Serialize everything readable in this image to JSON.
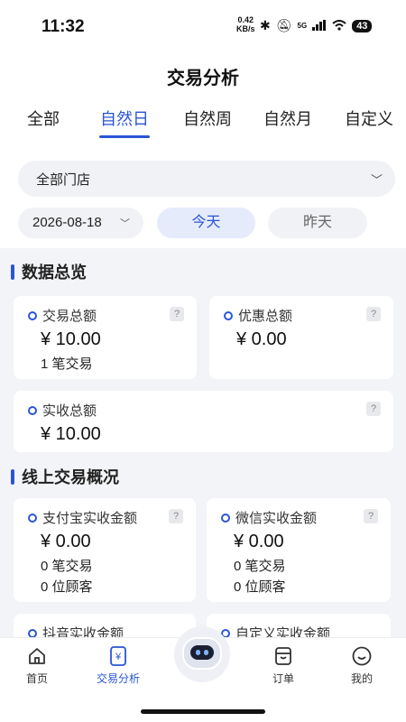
{
  "status": {
    "time": "11:32",
    "net_speed": "0.42",
    "net_unit": "KB/s",
    "signal": "5G",
    "battery": "43"
  },
  "title": "交易分析",
  "tabs": [
    {
      "label": "全部"
    },
    {
      "label": "自然日"
    },
    {
      "label": "自然周"
    },
    {
      "label": "自然月"
    },
    {
      "label": "自定义"
    }
  ],
  "active_tab": "自然日",
  "store_select": {
    "value": "全部门店"
  },
  "date_select": {
    "value": "2026-08-18"
  },
  "quick_dates": {
    "today": "今天",
    "yesterday": "昨天"
  },
  "overview": {
    "heading": "数据总览",
    "cards": [
      {
        "label": "交易总额",
        "value": "¥ 10.00",
        "line1": "1 笔交易"
      },
      {
        "label": "优惠总额",
        "value": "¥ 0.00"
      },
      {
        "label": "实收总额",
        "value": "¥ 10.00"
      }
    ]
  },
  "online": {
    "heading": "线上交易概况",
    "cards": [
      {
        "label": "支付宝实收金额",
        "value": "¥ 0.00",
        "line1": "0 笔交易",
        "line2": "0 位顾客"
      },
      {
        "label": "微信实收金额",
        "value": "¥ 0.00",
        "line1": "0 笔交易",
        "line2": "0 位顾客"
      },
      {
        "label": "抖音实收金额"
      },
      {
        "label": "自定义实收金额"
      }
    ]
  },
  "help_glyph": "?",
  "nav": [
    {
      "label": "首页",
      "icon": "home-icon"
    },
    {
      "label": "交易分析",
      "icon": "yuan-icon"
    },
    {
      "label": "",
      "icon": "robot-assistant-icon"
    },
    {
      "label": "订单",
      "icon": "order-icon"
    },
    {
      "label": "我的",
      "icon": "smile-icon"
    }
  ],
  "colors": {
    "accent": "#2a55d5",
    "background": "#f3f4f7"
  }
}
